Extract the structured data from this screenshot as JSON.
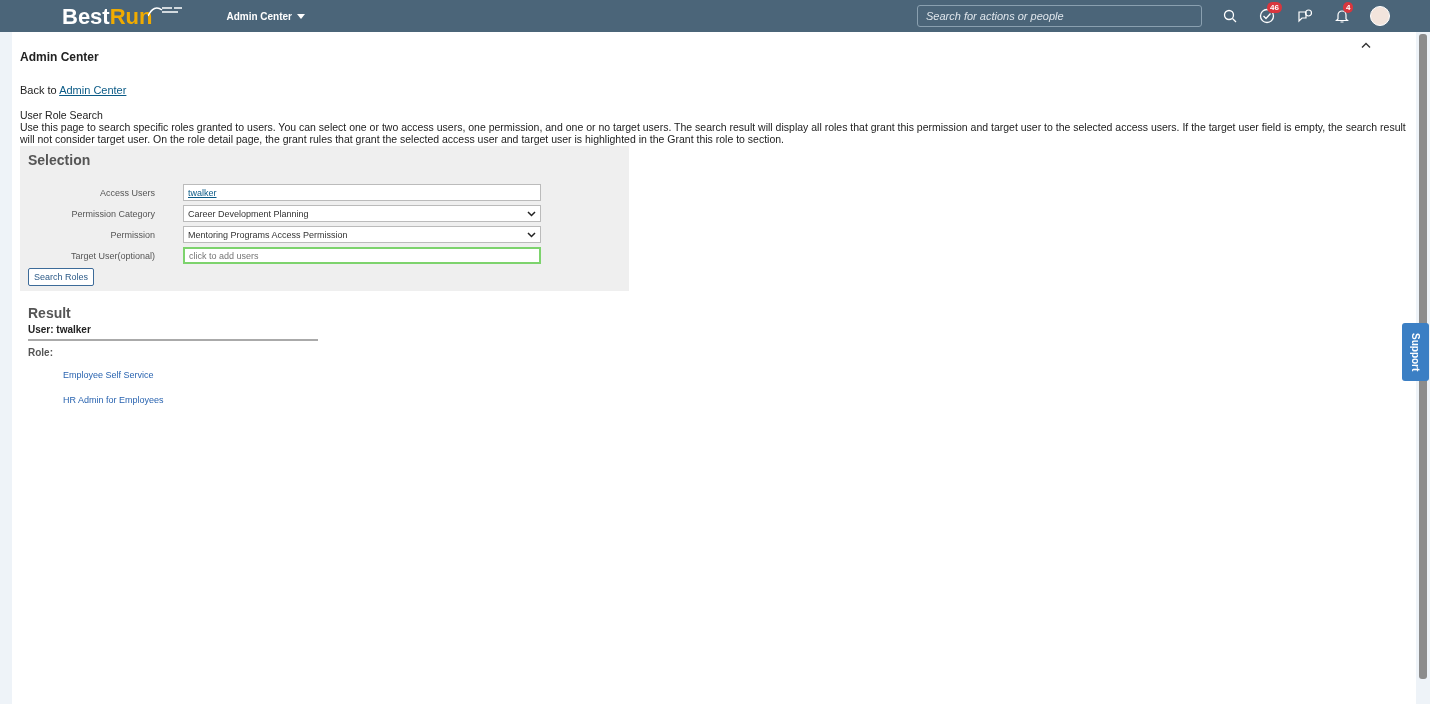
{
  "header": {
    "logo": {
      "part_1": "Best",
      "part_2": "Run"
    },
    "menu": "Admin Center",
    "search": {
      "placeholder": "Search for actions or people"
    },
    "todo_badge": "46",
    "notification_badge": "4"
  },
  "page": {
    "title": "Admin Center",
    "back_prefix": "Back to",
    "back_link": "Admin Center",
    "heading": "User Role Search",
    "description": "Use this page to search specific roles granted to users. You can select one or two access users, one permission, and one or no target users. The search result will display all roles that grant this permission and target user to the selected access users. If the target user field is empty, the search result will not consider target user. On the role detail page, the grant rules that grant the selected access user and target user is highlighted in the Grant this role to section."
  },
  "selection": {
    "title": "Selection",
    "fields": [
      {
        "kind": "users",
        "label": "Access Users",
        "value": "twalker"
      },
      {
        "kind": "select",
        "label": "Permission Category",
        "value": "Career Development Planning"
      },
      {
        "kind": "select",
        "label": "Permission",
        "value": "Mentoring Programs Access Permission"
      },
      {
        "kind": "input",
        "label": "Target User(optional)",
        "placeholder": "click to add users",
        "focused": true
      }
    ],
    "button": "Search Roles"
  },
  "result": {
    "title": "Result",
    "user": "User: twalker",
    "role_label": "Role:",
    "roles": [
      "Employee Self Service",
      "HR Admin for Employees"
    ]
  },
  "support": "Support"
}
